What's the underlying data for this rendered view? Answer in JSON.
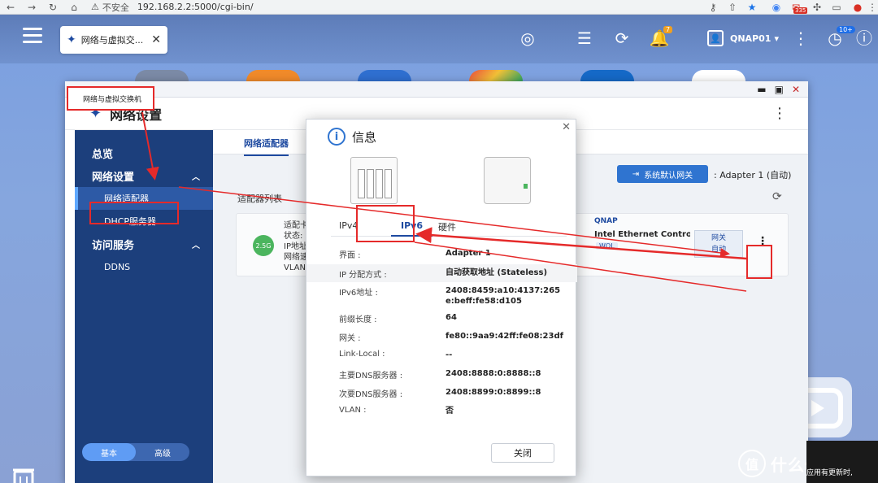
{
  "browser": {
    "insecure_label": "不安全",
    "url": "192.168.2.2:5000/cgi-bin/",
    "ext_badge": "335"
  },
  "topbar": {
    "window_tab": "网络与虚拟交...",
    "notif_count": "7",
    "user": "QNAP01",
    "update_badge": "10+"
  },
  "main_window": {
    "title": "网络与虚拟交换机",
    "header_title": "网络设置"
  },
  "sidebar": {
    "overview": "总览",
    "network_settings": "网络设置",
    "adapter": "网络适配器",
    "dhcp": "DHCP服务器",
    "access": "访问服务",
    "ddns": "DDNS",
    "toggle_basic": "基本",
    "toggle_adv": "高级"
  },
  "content": {
    "tab": "网络适配器",
    "gateway_button": "系统默认网关",
    "gateway_value": ": Adapter 1 (自动)",
    "list_title": "适配器列表",
    "adapter_badge": "2.5G",
    "adapter_fields": [
      "适配卡",
      "状态:",
      "IP地址",
      "网络速",
      "VLAN:"
    ],
    "vendor": "QNAP",
    "model": "Intel Ethernet Controller I",
    "wol": "WOL",
    "net_button_top": "网关",
    "net_button_bottom": "自动"
  },
  "dialog": {
    "title": "信息",
    "tabs": [
      "IPv4",
      "IPv6",
      "硬件"
    ],
    "rows": [
      {
        "k": "界面 :",
        "v": "Adapter 1"
      },
      {
        "k": "IP 分配方式 :",
        "v": "自动获取地址 (Stateless)"
      },
      {
        "k": "IPv6地址 :",
        "v": "2408:8459:a10:4137:265e:beff:fe58:d105"
      },
      {
        "k": "前缀长度 :",
        "v": "64"
      },
      {
        "k": "网关 :",
        "v": "fe80::9aa9:42ff:fe08:23df"
      },
      {
        "k": "Link-Local :",
        "v": "--"
      },
      {
        "k": "主要DNS服务器 :",
        "v": "2408:8888:0:8888::8"
      },
      {
        "k": "次要DNS服务器 :",
        "v": "2408:8899:0:8899::8"
      },
      {
        "k": "VLAN :",
        "v": "否"
      }
    ],
    "close_button": "关闭"
  },
  "watermark": {
    "circle": "值",
    "text": "什么值得买",
    "sub": "应用有更新时,"
  },
  "colors": {
    "accent": "#1e4aa0",
    "sidebar_bg": "#1c3f7c",
    "annotation": "#e52a2a"
  }
}
